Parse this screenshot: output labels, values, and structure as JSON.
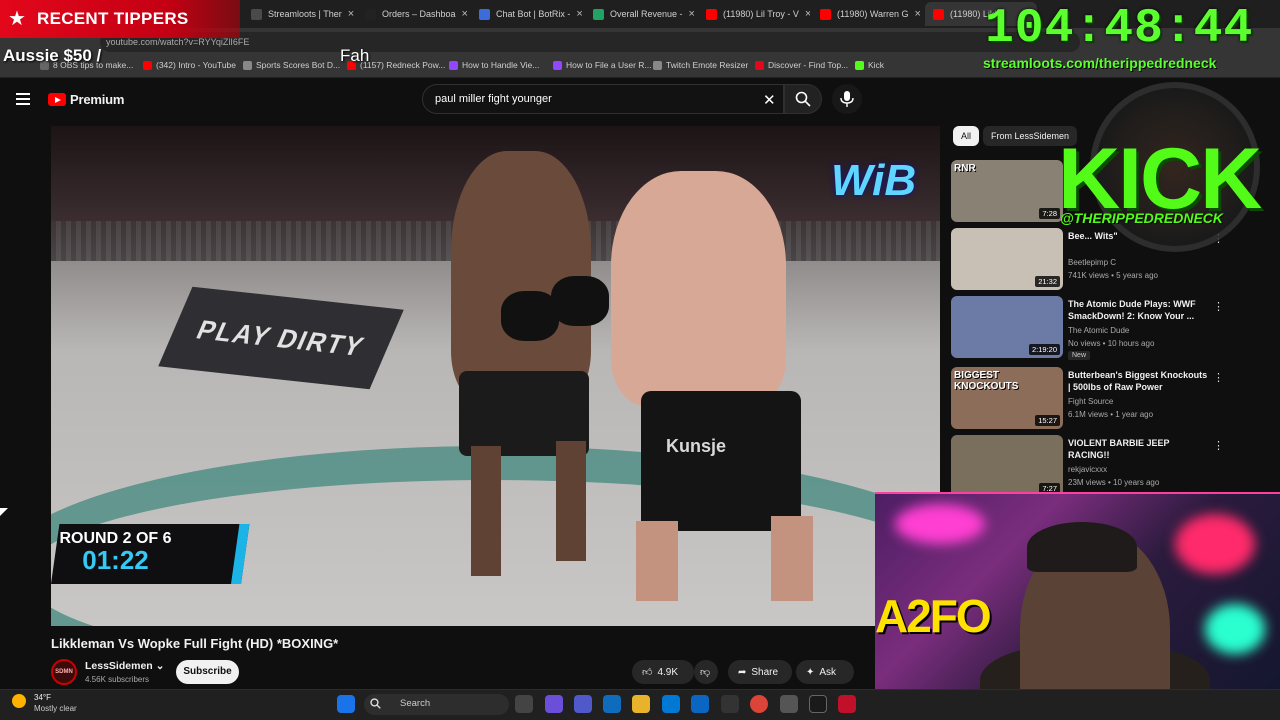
{
  "browser": {
    "tabs": [
      {
        "label": "Streamloots | Ther",
        "color": "#4a4a4a"
      },
      {
        "label": "Orders – Dashboa",
        "color": "#222222"
      },
      {
        "label": "Chat Bot | BotRix -",
        "color": "#3c6bdc"
      },
      {
        "label": "Overall Revenue -",
        "color": "#1fa463"
      },
      {
        "label": "(11980) Lil Troy - V",
        "color": "#ff0000"
      },
      {
        "label": "(11980) Warren G",
        "color": "#ff0000"
      },
      {
        "label": "(11980) Likkl",
        "color": "#ff0000"
      }
    ],
    "url": "youtube.com/watch?v=RYYqiZlI6FE",
    "bookmarks": [
      {
        "label": "8 OBS tips to make...",
        "color": "#666666"
      },
      {
        "label": "(342) Intro - YouTube",
        "color": "#ff0000"
      },
      {
        "label": "Sports Scores Bot D...",
        "color": "#888888"
      },
      {
        "label": "(1157) Redneck Pow...",
        "color": "#ff0000"
      },
      {
        "label": "How to Handle Vie...",
        "color": "#9146ff"
      },
      {
        "label": "How to File a User R...",
        "color": "#9146ff"
      },
      {
        "label": "Twitch Emote Resizer",
        "color": "#888888"
      },
      {
        "label": "Discover - Find Top...",
        "color": "#e3071b"
      },
      {
        "label": "Kick",
        "color": "#53fc18"
      }
    ]
  },
  "youtube": {
    "logo_text": "Premium",
    "search_query": "paul miller fight younger",
    "video": {
      "mat_text": "PLAY DIRTY",
      "brand_text": "WiB",
      "shorts_text": "Kunsje",
      "round_label": "ROUND 2 OF 6",
      "round_time": "01:22",
      "title": "Likkleman Vs Wopke Full Fight (HD) *BOXING*"
    },
    "channel": {
      "avatar_text": "SDMN",
      "name": "LessSidemen",
      "subscribers": "4.56K subscribers",
      "subscribe_label": "Subscribe"
    },
    "actions": {
      "likes": "4.9K",
      "share": "Share",
      "ask": "Ask"
    },
    "chips": [
      "All",
      "From LessSidemen"
    ],
    "recommendations": [
      {
        "title": "",
        "channel": "",
        "meta": "",
        "duration": "7:28",
        "thumb_text": "RNR",
        "thumb_bg": "#8a8175"
      },
      {
        "title": "Bee... Wits\"",
        "channel": "Beetlepimp C",
        "meta": "741K views • 5 years ago",
        "duration": "21:32",
        "thumb_bg": "#c9c0b5"
      },
      {
        "title": "The Atomic Dude Plays: WWF SmackDown! 2: Know Your ...",
        "channel": "The Atomic Dude",
        "meta": "No views • 10 hours ago",
        "duration": "2:19:20",
        "thumb_bg": "#6c7aa6",
        "badge": "New"
      },
      {
        "title": "Butterbean's Biggest Knockouts | 500lbs of Raw Power",
        "channel": "Fight Source",
        "meta": "6.1M views • 1 year ago",
        "duration": "15:27",
        "thumb_text": "BIGGEST KNOCKOUTS",
        "thumb_bg": "#8b6d5a"
      },
      {
        "title": "VIOLENT BARBIE JEEP RACING!!",
        "channel": "rekjavicxxx",
        "meta": "23M views • 10 years ago",
        "duration": "7:27",
        "thumb_bg": "#7a6f5c"
      }
    ]
  },
  "overlay": {
    "tippers_title": "RECENT TIPPERS",
    "tipper_entry": "Aussie $50 /",
    "tipper_entry_2": "Fah",
    "timer": "104:48:44",
    "stream_url": "streamloots.com/therippedredneck",
    "kick_text": "KICK",
    "kick_handle": "@THERIPPEDREDNECK",
    "webcam_sign": "A2FO"
  },
  "taskbar": {
    "temperature": "34°F",
    "condition": "Mostly clear",
    "search_label": "Search"
  },
  "colors": {
    "youtube_red": "#ff0000",
    "kick_green": "#53fc18",
    "timer_green": "#5cff2e",
    "tipper_red": "#e3071b",
    "round_blue": "#36c9f5"
  }
}
